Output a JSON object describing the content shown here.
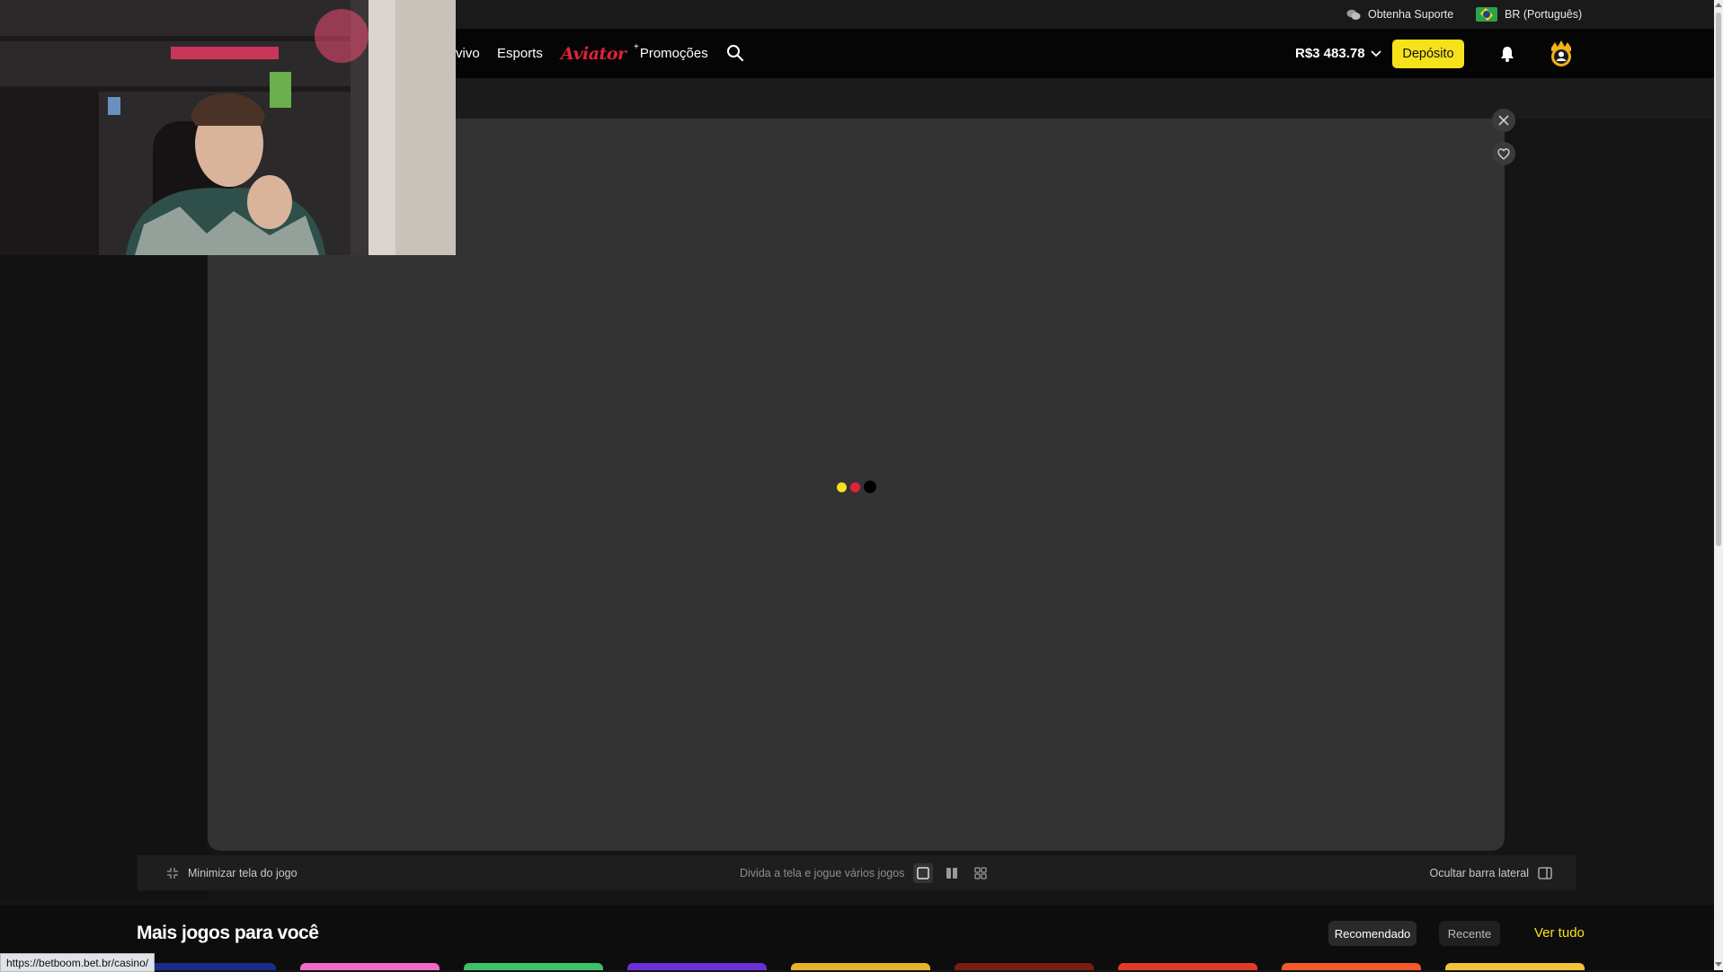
{
  "topbar": {
    "support_label": "Obtenha Suporte",
    "language_label": "BR (Português)"
  },
  "nav": {
    "items": [
      {
        "label": "vivo"
      },
      {
        "label": "Esports"
      },
      {
        "label": "Aviator"
      },
      {
        "label": "Promoções",
        "badge": "+"
      }
    ],
    "balance": "R$3 483.78",
    "deposit_label": "Depósito"
  },
  "game": {
    "loader_colors": [
      "#f5e21a",
      "#e0233b",
      "#000000"
    ]
  },
  "controls": {
    "minimize_label": "Minimizar tela do jogo",
    "split_label": "Divida a tela e jogue vários jogos",
    "hide_sidebar_label": "Ocultar barra lateral"
  },
  "more_games": {
    "title": "Mais jogos para você",
    "tabs": [
      {
        "label": "Recomendado",
        "active": true
      },
      {
        "label": "Recente",
        "active": false
      }
    ],
    "see_all_label": "Ver tudo",
    "thumbnail_colors": [
      "#1a2d8a",
      "#f06ac8",
      "#3fbf6a",
      "#6b2fd8",
      "#e8b32a",
      "#7a1d12",
      "#e23a2a",
      "#f25a2c",
      "#f2c23a"
    ]
  },
  "status_bar": {
    "url": "https://betboom.bet.br/casino/"
  },
  "theme": {
    "accent": "#f5e21a",
    "brand_red": "#e0233b"
  }
}
